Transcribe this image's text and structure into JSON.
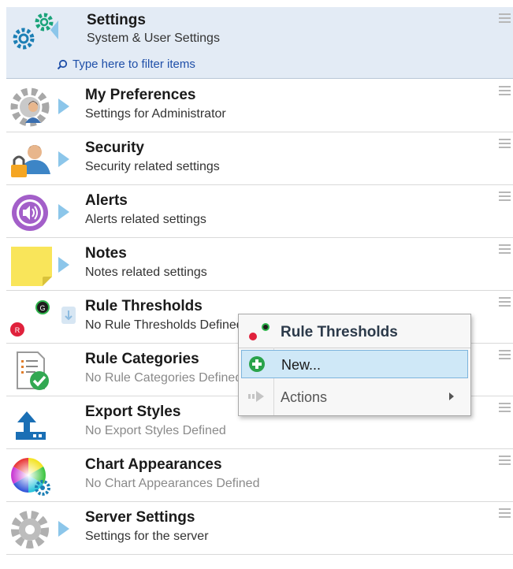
{
  "header": {
    "title": "Settings",
    "subtitle": "System & User Settings",
    "filter_placeholder": "Type here to filter items"
  },
  "items": [
    {
      "title": "My Preferences",
      "subtitle": "Settings for Administrator",
      "icon": "gear-user-icon"
    },
    {
      "title": "Security",
      "subtitle": "Security related settings",
      "icon": "user-lock-icon"
    },
    {
      "title": "Alerts",
      "subtitle": "Alerts related settings",
      "icon": "speaker-icon"
    },
    {
      "title": "Notes",
      "subtitle": "Notes related settings",
      "icon": "sticky-note-icon"
    },
    {
      "title": "Rule Thresholds",
      "subtitle": "No Rule Thresholds Defined",
      "icon": "red-green-dots-icon"
    },
    {
      "title": "Rule Categories",
      "subtitle": "No Rule Categories Defined",
      "icon": "checklist-icon"
    },
    {
      "title": "Export Styles",
      "subtitle": "No Export Styles Defined",
      "icon": "export-arrow-icon"
    },
    {
      "title": "Chart Appearances",
      "subtitle": "No Chart Appearances Defined",
      "icon": "color-wheel-icon"
    },
    {
      "title": "Server Settings",
      "subtitle": "Settings for the server",
      "icon": "gear-icon"
    }
  ],
  "context_menu": {
    "title": "Rule Thresholds",
    "items": [
      {
        "label": "New...",
        "highlighted": true,
        "icon": "plus-circle-icon"
      },
      {
        "label": "Actions",
        "has_submenu": true,
        "icon": "arrow-right-icon"
      }
    ]
  },
  "colors": {
    "header_bg": "#e3ebf5",
    "menu_highlight": "#cfe8f7",
    "accent_blue": "#1f4fa8",
    "arrow_blue": "#8cc6ea"
  }
}
